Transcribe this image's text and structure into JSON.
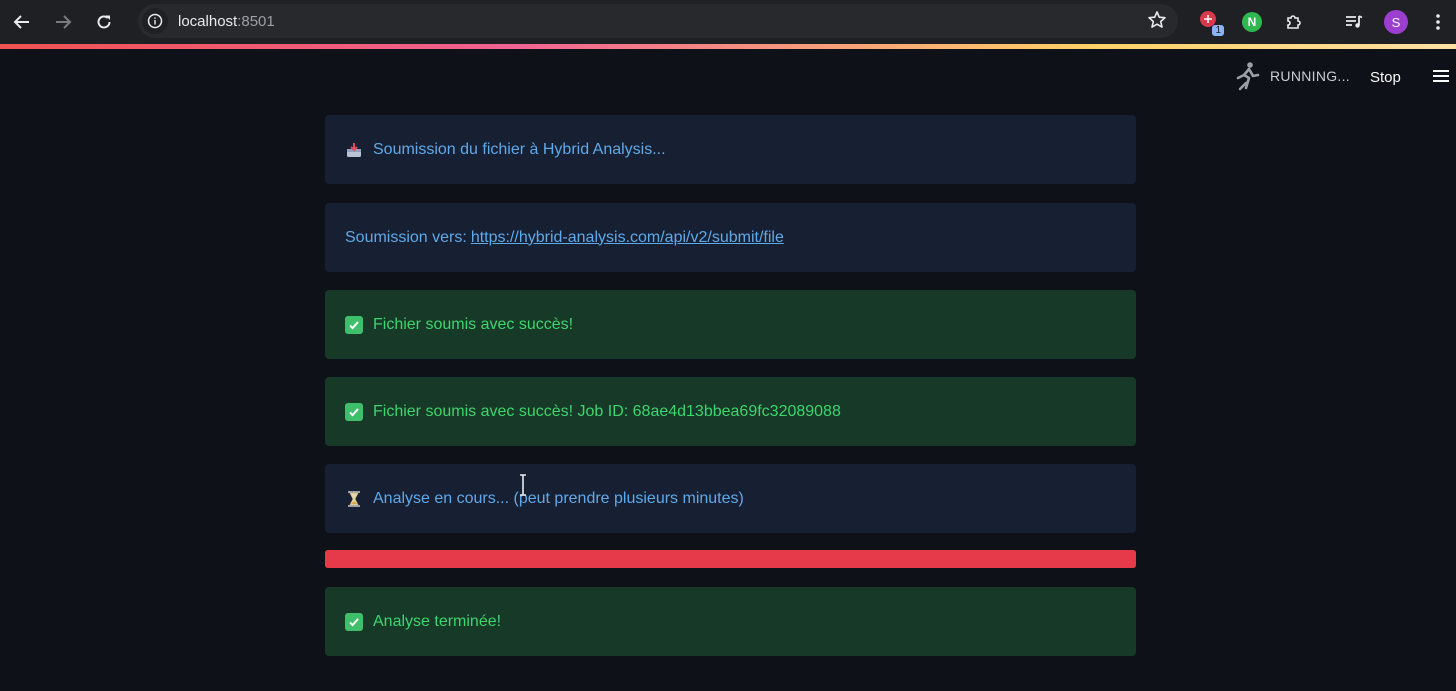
{
  "browser": {
    "url_host": "localhost",
    "url_port": ":8501",
    "profile_initial": "S",
    "ext_badge": "1",
    "ext_n_letter": "N"
  },
  "streamlit": {
    "status": "RUNNING...",
    "stop_label": "Stop"
  },
  "alerts": [
    {
      "type": "info",
      "icon": "inbox-tray-icon",
      "text": "Soumission du fichier à Hybrid Analysis..."
    },
    {
      "type": "info",
      "text": "Soumission vers:",
      "link": "https://hybrid-analysis.com/api/v2/submit/file"
    },
    {
      "type": "success",
      "icon": "check-mark-icon",
      "text": "Fichier soumis avec succès!"
    },
    {
      "type": "success",
      "icon": "check-mark-icon",
      "text": "Fichier soumis avec succès! Job ID: 68ae4d13bbea69fc32089088"
    },
    {
      "type": "info",
      "icon": "hourglass-icon",
      "text": "Analyse en cours... (peut prendre plusieurs minutes)"
    },
    {
      "type": "success",
      "icon": "check-mark-icon",
      "text": "Analyse terminée!"
    }
  ],
  "progress": {
    "value": 1.0,
    "color": "#e6394a"
  },
  "colors": {
    "info_bg": "#172033",
    "info_text": "#5ea9ea",
    "success_bg": "#173928",
    "success_text": "#3dd56d",
    "page_bg": "#0e1117"
  }
}
